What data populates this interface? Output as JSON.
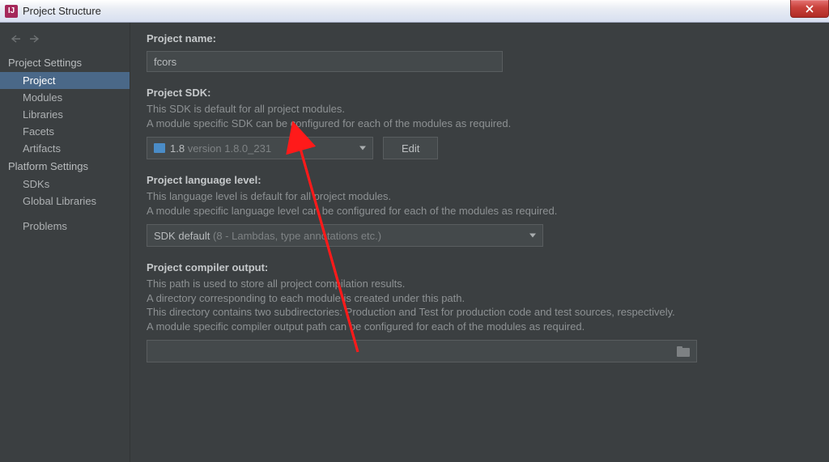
{
  "window": {
    "title": "Project Structure"
  },
  "sidebar": {
    "section1_label": "Project Settings",
    "items1": {
      "project": "Project",
      "modules": "Modules",
      "libraries": "Libraries",
      "facets": "Facets",
      "artifacts": "Artifacts"
    },
    "section2_label": "Platform Settings",
    "items2": {
      "sdks": "SDKs",
      "global_libraries": "Global Libraries"
    },
    "problems": "Problems"
  },
  "main": {
    "project_name_label": "Project name:",
    "project_name_value": "fcors",
    "sdk_label": "Project SDK:",
    "sdk_help1": "This SDK is default for all project modules.",
    "sdk_help2": "A module specific SDK can be configured for each of the modules as required.",
    "sdk_value_primary": "1.8",
    "sdk_value_secondary": "version 1.8.0_231",
    "edit_label": "Edit",
    "lang_level_label": "Project language level:",
    "lang_help1": "This language level is default for all project modules.",
    "lang_help2": "A module specific language level can be configured for each of the modules as required.",
    "lang_value_primary": "SDK default",
    "lang_value_secondary": "(8 - Lambdas, type annotations etc.)",
    "output_label": "Project compiler output:",
    "output_help1": "This path is used to store all project compilation results.",
    "output_help2": "A directory corresponding to each module is created under this path.",
    "output_help3": "This directory contains two subdirectories: Production and Test for production code and test sources, respectively.",
    "output_help4": "A module specific compiler output path can be configured for each of the modules as required."
  }
}
